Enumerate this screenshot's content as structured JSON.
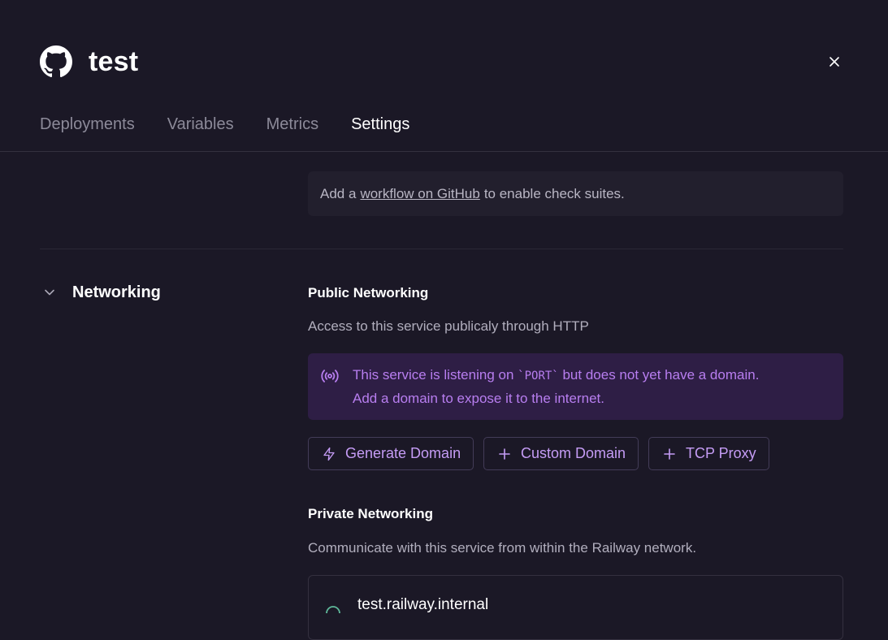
{
  "header": {
    "title": "test",
    "logo_icon": "github-icon",
    "close_icon": "close-icon"
  },
  "tabs": [
    {
      "label": "Deployments",
      "active": false
    },
    {
      "label": "Variables",
      "active": false
    },
    {
      "label": "Metrics",
      "active": false
    },
    {
      "label": "Settings",
      "active": true
    }
  ],
  "check_suites": {
    "prefix": "Add a",
    "link": "workflow on GitHub",
    "suffix": "to enable check suites."
  },
  "networking": {
    "section_label": "Networking",
    "public": {
      "title": "Public Networking",
      "description": "Access to this service publicaly through HTTP",
      "alert_line1_pre": "This service is listening on",
      "alert_code": "`PORT`",
      "alert_line1_post": "but does not yet have a domain.",
      "alert_line2": "Add a domain to expose it to the internet.",
      "buttons": [
        {
          "label": "Generate Domain",
          "icon": "lightning-icon"
        },
        {
          "label": "Custom Domain",
          "icon": "plus-icon"
        },
        {
          "label": "TCP Proxy",
          "icon": "plus-icon"
        }
      ]
    },
    "private": {
      "title": "Private Networking",
      "description": "Communicate with this service from within the Railway network.",
      "internal_domain": "test.railway.internal"
    }
  },
  "colors": {
    "background": "#1b1826",
    "accent_purple": "#b87ef0",
    "alert_bg": "#2e1e45"
  }
}
